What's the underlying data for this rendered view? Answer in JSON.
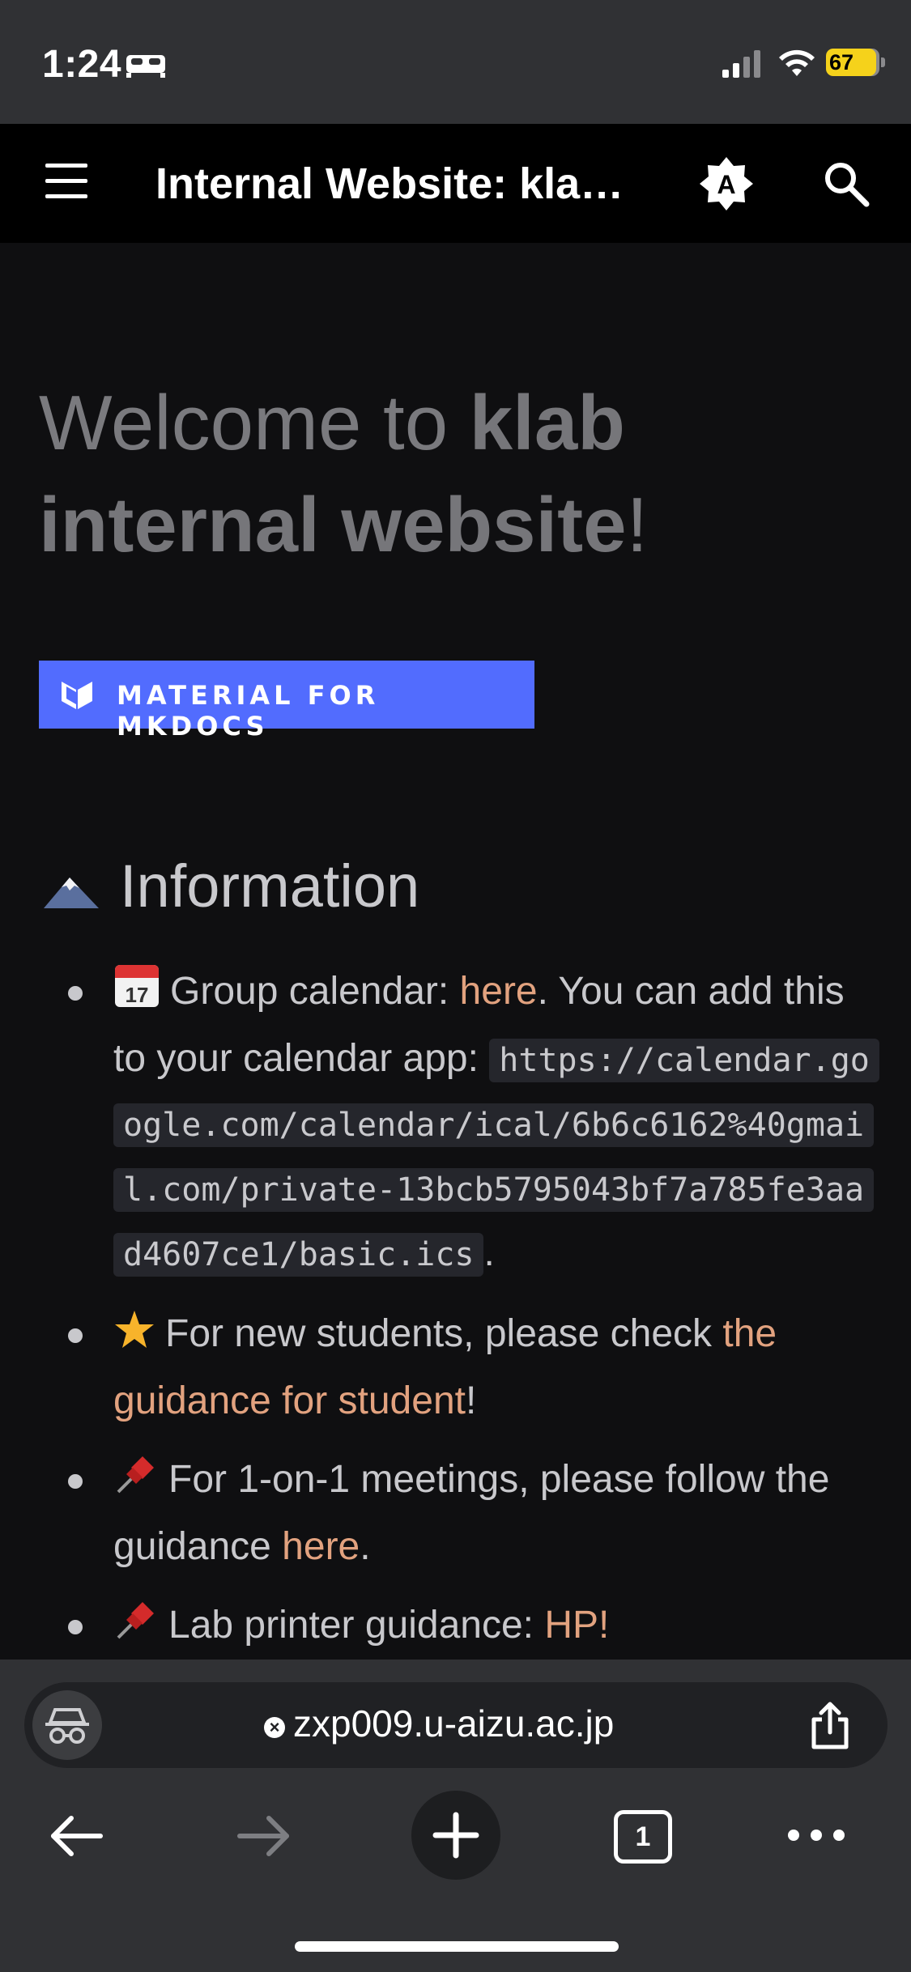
{
  "status_bar": {
    "time": "1:24",
    "battery": "67"
  },
  "header": {
    "title": "Internal Website: klab internal website"
  },
  "welcome": {
    "prefix": "Welcome to ",
    "bold": "klab internal website",
    "suffix": "!"
  },
  "badge": {
    "label": "MATERIAL FOR MKDOCS"
  },
  "section": {
    "heading": "Information"
  },
  "items": [
    {
      "pre": "Group calendar: ",
      "link": "here",
      "post": ". You can add this to your calendar app: ",
      "code": "https://calendar.google.com/calendar/ical/6b6c6162%40gmail.com/private-13bcb5795043bf7a785fe3aad4607ce1/basic.ics",
      "end": "."
    },
    {
      "pre": "For new students, please check ",
      "link": "the guidance for student",
      "post": "!"
    },
    {
      "pre": "For 1-on-1 meetings, please follow the guidance ",
      "link": "here",
      "post": "."
    },
    {
      "pre": "Lab printer guidance: ",
      "link": "HP!",
      "post": ""
    }
  ],
  "browser": {
    "url": "zxp009.u-aizu.ac.jp",
    "tab_count": "1"
  },
  "colors": {
    "accent": "#526cfe",
    "link": "#e2a27f",
    "battery": "#f5d21b"
  }
}
